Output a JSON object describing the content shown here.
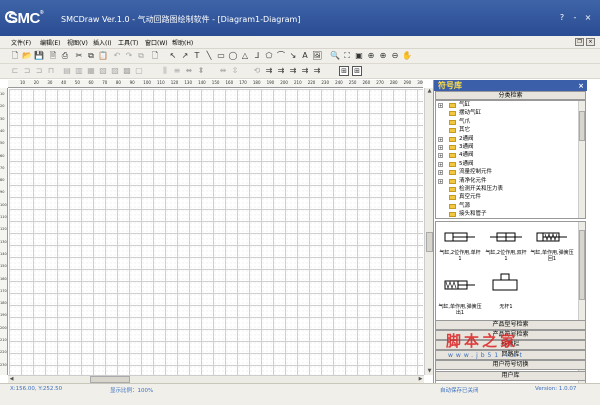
{
  "titlebar": {
    "logo_text": "SMC",
    "title": "SMCDraw Ver.1.0 - 气动回路图绘制软件 - [Diagram1-Diagram]",
    "help_btn": "?",
    "min_btn": "-",
    "close_btn": "×"
  },
  "menubar": {
    "items": [
      "文件(F)",
      "编辑(E)",
      "视图(V)",
      "插入(I)",
      "工具(T)",
      "窗口(W)",
      "帮助(H)"
    ]
  },
  "ruler": {
    "top_labels": [
      "10",
      "20",
      "30",
      "40",
      "50",
      "60",
      "70",
      "80",
      "90",
      "100",
      "110",
      "120",
      "130",
      "140",
      "150",
      "160",
      "170",
      "180",
      "190",
      "200",
      "210",
      "220",
      "230",
      "240",
      "250",
      "260",
      "270",
      "280",
      "290",
      "300"
    ],
    "left_labels": [
      "10",
      "20",
      "30",
      "40",
      "50",
      "60",
      "70",
      "80",
      "90",
      "100",
      "110",
      "120",
      "130",
      "140",
      "150",
      "160",
      "170",
      "180",
      "190",
      "200",
      "210",
      "220",
      "230"
    ]
  },
  "panel": {
    "title": "符号库",
    "category_header": "分类检索",
    "tree_items": [
      {
        "label": "气缸",
        "expandable": true
      },
      {
        "label": "摆动气缸",
        "expandable": false
      },
      {
        "label": "气爪",
        "expandable": false
      },
      {
        "label": "其它",
        "expandable": false
      },
      {
        "label": "2通阀",
        "expandable": true
      },
      {
        "label": "3通阀",
        "expandable": true
      },
      {
        "label": "4通阀",
        "expandable": true
      },
      {
        "label": "5通阀",
        "expandable": true
      },
      {
        "label": "流量控制元件",
        "expandable": true
      },
      {
        "label": "清净化元件",
        "expandable": true
      },
      {
        "label": "检测开关和压力表",
        "expandable": false
      },
      {
        "label": "真空元件",
        "expandable": false
      },
      {
        "label": "气源",
        "expandable": false
      },
      {
        "label": "接头和管子",
        "expandable": false
      }
    ],
    "symbols": [
      {
        "caption": "气缸,2位作用,单杆1"
      },
      {
        "caption": "气缸,2位作用,双杆1"
      },
      {
        "caption": "气缸,单作用,弹簧压回1"
      },
      {
        "caption": "气缸,单作用,弹簧压出1"
      },
      {
        "caption": "无杆1"
      }
    ],
    "buttons": [
      "产品型号检索",
      "产品符号检索",
      "标题栏",
      "回路库",
      "用户符号切换",
      "用户库"
    ]
  },
  "watermark": {
    "chinese": "脚本之家",
    "url": "www.jb51.net"
  },
  "status": {
    "coords": "X:156.00, Y:252.50",
    "zoom": "显示比例：100%",
    "autosave": "自动保存已关闭",
    "version": "Version: 1.0.07"
  }
}
